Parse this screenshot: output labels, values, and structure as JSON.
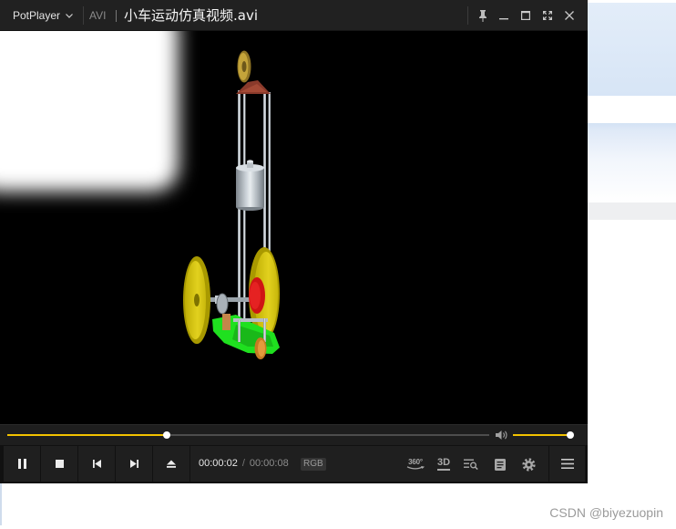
{
  "window": {
    "app_name": "PotPlayer",
    "format_label": "AVI",
    "title": "小车运动仿真视频.avi"
  },
  "playback": {
    "current_time": "00:00:02",
    "time_separator": "/",
    "total_time": "00:00:08",
    "color_format": "RGB",
    "progress": 0.33,
    "volume": 0.95
  },
  "toolbar": {
    "label_360": "360°",
    "label_3d": "3D"
  },
  "icons": {
    "title_bar": [
      "chevron-down-icon",
      "pin-icon",
      "minimize-icon",
      "maximize-icon",
      "fullscreen-icon",
      "close-icon"
    ],
    "controls": [
      "pause-icon",
      "stop-icon",
      "previous-icon",
      "next-icon",
      "eject-icon"
    ],
    "tools": [
      "360-video-icon",
      "3d-icon",
      "playlist-search-icon",
      "subtitle-icon",
      "settings-gear-icon",
      "menu-icon"
    ],
    "volume": "volume-icon"
  },
  "colors": {
    "accent": "#f2c200",
    "title_bar": "#212121",
    "control_bar": "#1f1f1f",
    "video_background": "#000000",
    "text_primary": "#ffffff",
    "text_secondary": "#8c8c8c"
  },
  "watermark": "CSDN @biyezuopin"
}
